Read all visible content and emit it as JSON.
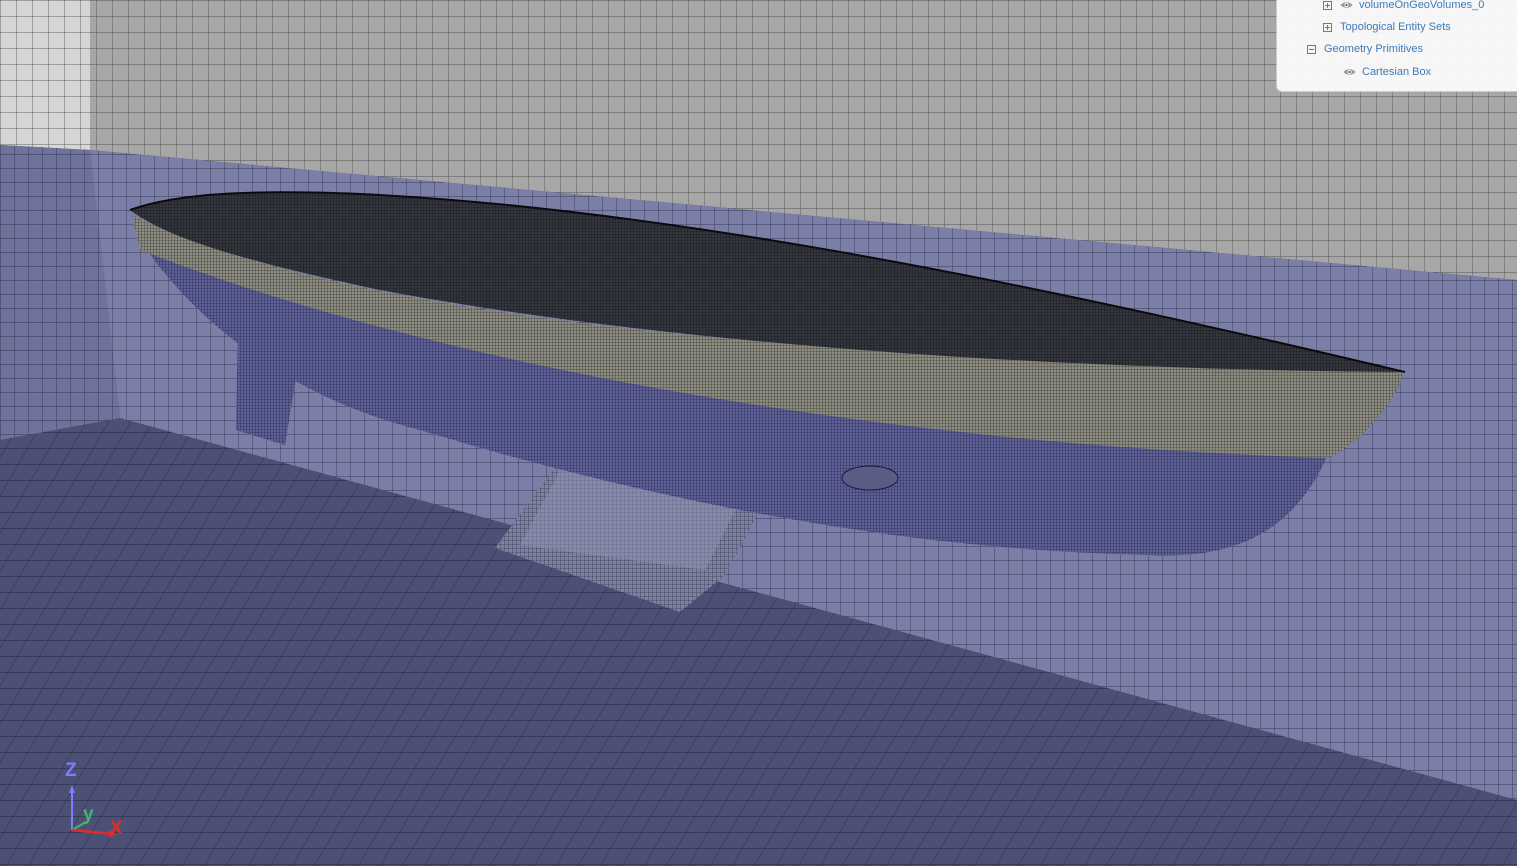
{
  "tree": {
    "items": [
      {
        "label": "volumeOnGeoVolumes_0"
      },
      {
        "label": "Topological Entity Sets"
      },
      {
        "label": "Geometry Primitives"
      },
      {
        "label": "Cartesian Box"
      }
    ]
  },
  "axes": {
    "z": "Z",
    "y": "y",
    "x": "X",
    "z_color": "#7d7dff",
    "y_color": "#3fb86a",
    "x_color": "#e02b2b"
  },
  "colors": {
    "wall_back": "#a7a7a7",
    "wall_side": "#7b7ea6",
    "floor": "#4d5075",
    "hull": "#2b2f38",
    "link": "#3d7ab8"
  }
}
